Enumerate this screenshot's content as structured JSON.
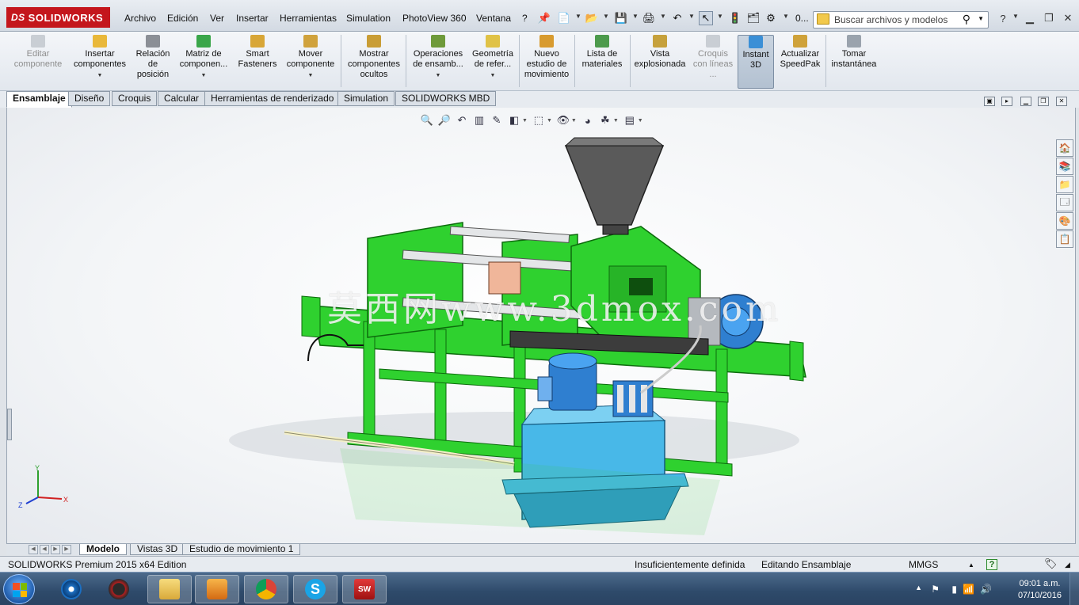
{
  "app": {
    "logo": "SOLIDWORKS",
    "logo_prefix": "DS"
  },
  "menu": [
    "Archivo",
    "Edición",
    "Ver",
    "Insertar",
    "Herramientas",
    "Simulation",
    "PhotoView 360",
    "Ventana",
    "?"
  ],
  "quick_access": {
    "rebuild_value": "0..."
  },
  "search": {
    "placeholder": "Buscar archivos y modelos"
  },
  "help_label": "?",
  "command_manager": [
    {
      "label": "Editar componente",
      "disabled": true,
      "has_menu": false
    },
    {
      "label": "Insertar componentes",
      "disabled": false,
      "has_menu": true
    },
    {
      "label": "Relación de posición",
      "disabled": false,
      "has_menu": false
    },
    {
      "label": "Matriz de componen...",
      "disabled": false,
      "has_menu": true
    },
    {
      "label": "Smart Fasteners",
      "disabled": false,
      "has_menu": false
    },
    {
      "label": "Mover componente",
      "disabled": false,
      "has_menu": true
    },
    {
      "label": "Mostrar componentes ocultos",
      "disabled": false,
      "has_menu": false
    },
    {
      "label": "Operaciones de ensamb...",
      "disabled": false,
      "has_menu": true
    },
    {
      "label": "Geometría de refer...",
      "disabled": false,
      "has_menu": true
    },
    {
      "label": "Nuevo estudio de movimiento",
      "disabled": false,
      "has_menu": false
    },
    {
      "label": "Lista de materiales",
      "disabled": false,
      "has_menu": false
    },
    {
      "label": "Vista explosionada",
      "disabled": false,
      "has_menu": false
    },
    {
      "label": "Croquis con líneas ...",
      "disabled": true,
      "has_menu": false
    },
    {
      "label": "Instant 3D",
      "disabled": false,
      "has_menu": false,
      "active": true
    },
    {
      "label": "Actualizar SpeedPak",
      "disabled": false,
      "has_menu": false
    },
    {
      "label": "Tomar instantánea",
      "disabled": false,
      "has_menu": false
    }
  ],
  "tabs": [
    "Ensamblaje",
    "Diseño",
    "Croquis",
    "Calcular",
    "Herramientas de renderizado",
    "Simulation",
    "SOLIDWORKS MBD"
  ],
  "active_tab": "Ensamblaje",
  "watermark": "莫西网www.3dmox.com",
  "triad": {
    "x": "X",
    "y": "Y",
    "z": "Z"
  },
  "bottom_tabs": [
    "Modelo",
    "Vistas 3D",
    "Estudio de movimiento 1"
  ],
  "status": {
    "edition": "SOLIDWORKS Premium 2015 x64 Edition",
    "definition": "Insuficientemente definida",
    "mode": "Editando Ensamblaje",
    "units": "MMGS",
    "units_caret": "▲",
    "help": "?"
  },
  "taskbar": {
    "apps": [
      "file-explorer",
      "media-player",
      "chrome",
      "skype",
      "solidworks-2015"
    ],
    "time": "09:01 a.m.",
    "date": "07/10/2016"
  },
  "colors": {
    "accent_red": "#c4161c",
    "frame_green": "#2fd12f",
    "tank_blue": "#48b8e8",
    "motor_blue": "#2f7fd0"
  }
}
